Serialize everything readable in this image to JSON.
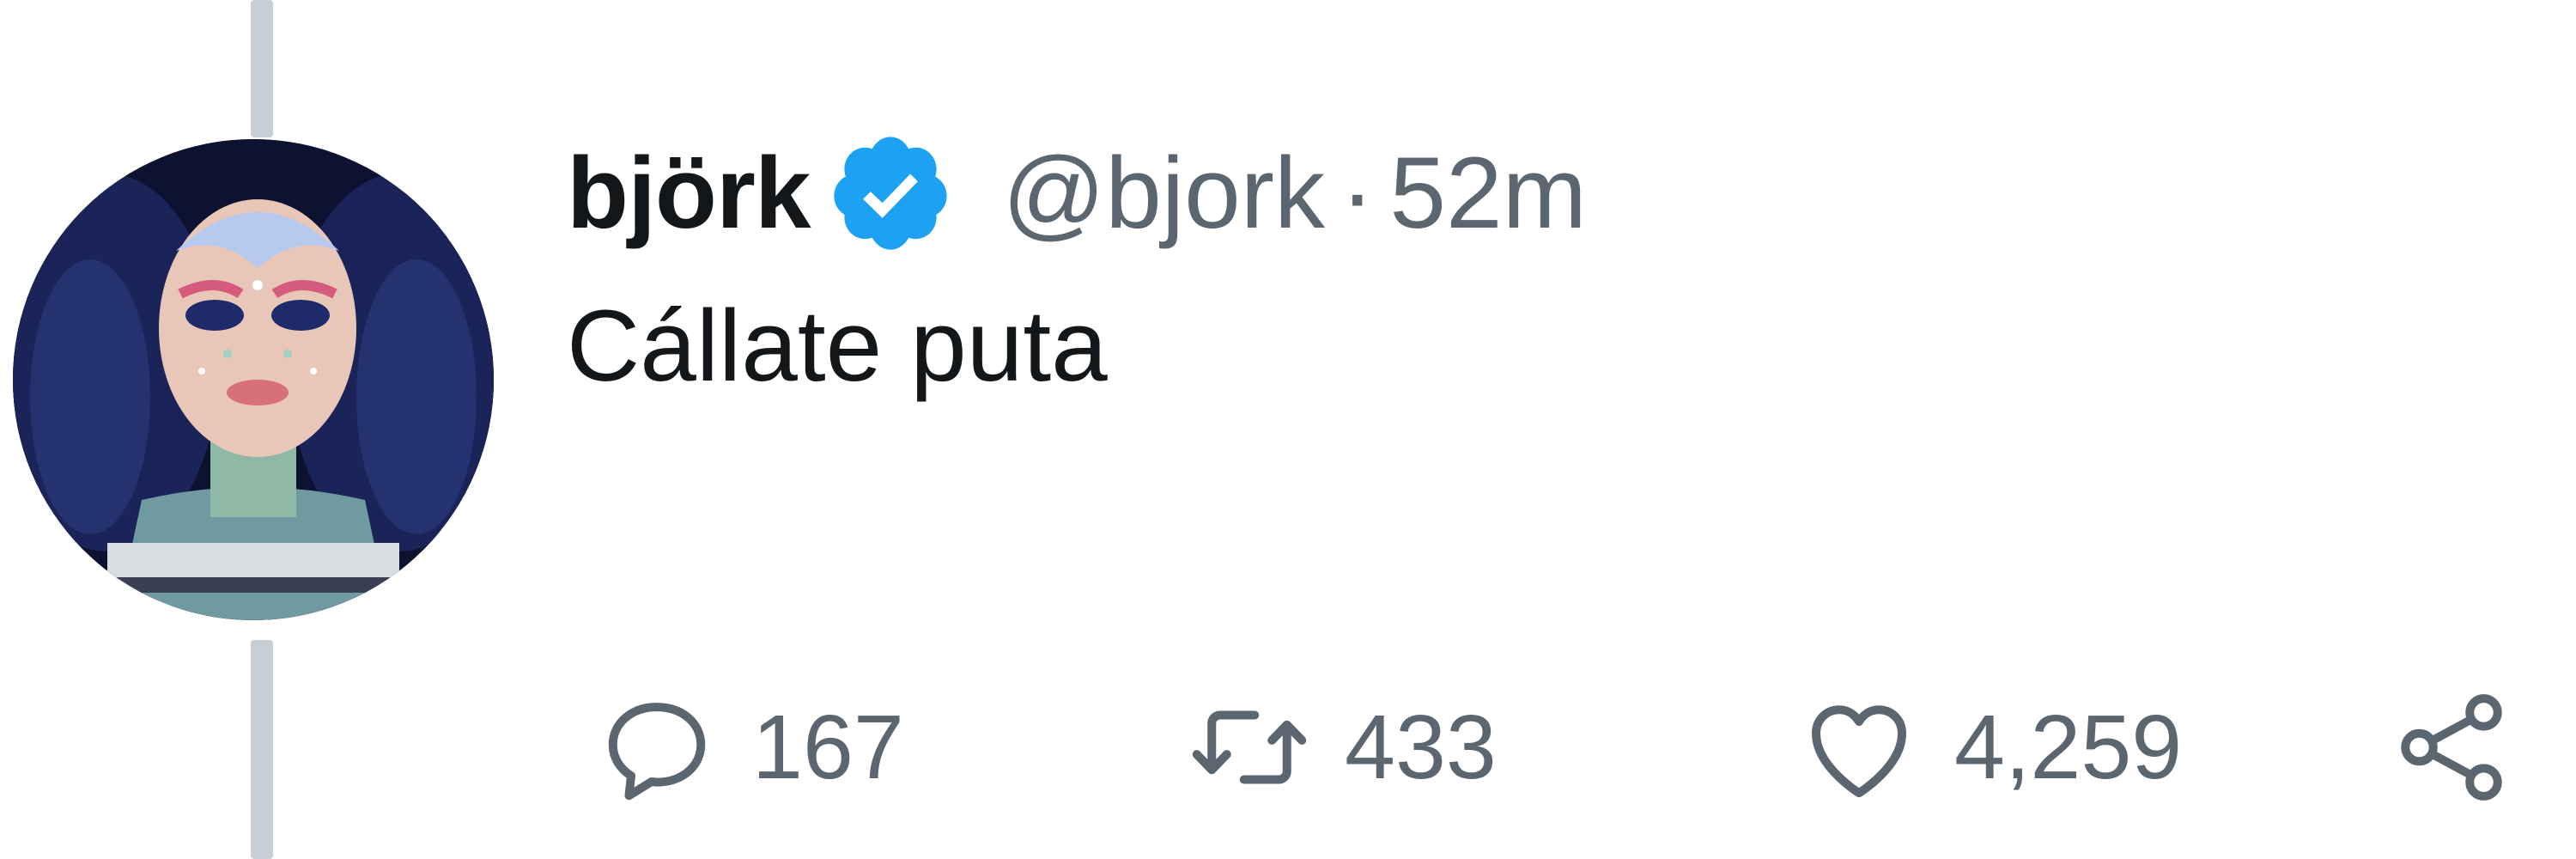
{
  "tweet": {
    "display_name": "björk",
    "verified": true,
    "handle": "@bjork",
    "separator": "·",
    "time": "52m",
    "text": "Cállate puta"
  },
  "actions": {
    "reply": {
      "icon": "reply-icon",
      "count": "167"
    },
    "retweet": {
      "icon": "retweet-icon",
      "count": "433"
    },
    "like": {
      "icon": "heart-icon",
      "count": "4,259"
    },
    "share": {
      "icon": "share-icon"
    }
  },
  "colors": {
    "verified_badge": "#1da1f2",
    "secondary_text": "#5b6670",
    "primary_text": "#14171a",
    "thread_line": "#c7cfd6"
  }
}
